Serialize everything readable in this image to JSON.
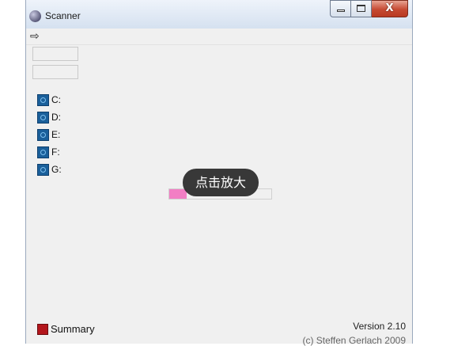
{
  "window": {
    "title": "Scanner",
    "close_glyph": "X"
  },
  "toolbar": {
    "back_icon": "arrow-right-icon",
    "back_glyph": "⇨"
  },
  "path_boxes": [
    "",
    ""
  ],
  "drives": [
    {
      "label": "C:",
      "icon": "drive-icon"
    },
    {
      "label": "D:",
      "icon": "drive-icon"
    },
    {
      "label": "E:",
      "icon": "drive-icon"
    },
    {
      "label": "F:",
      "icon": "drive-icon"
    },
    {
      "label": "G:",
      "icon": "drive-icon"
    }
  ],
  "progress": {
    "fraction": 0.17,
    "fill_color": "#f27ec4"
  },
  "overlay": {
    "zoom_hint": "点击放大"
  },
  "footer": {
    "summary_label": "Summary",
    "summary_color": "#b3161c",
    "version": "Version 2.10",
    "copyright": "(c) Steffen Gerlach 2009"
  }
}
